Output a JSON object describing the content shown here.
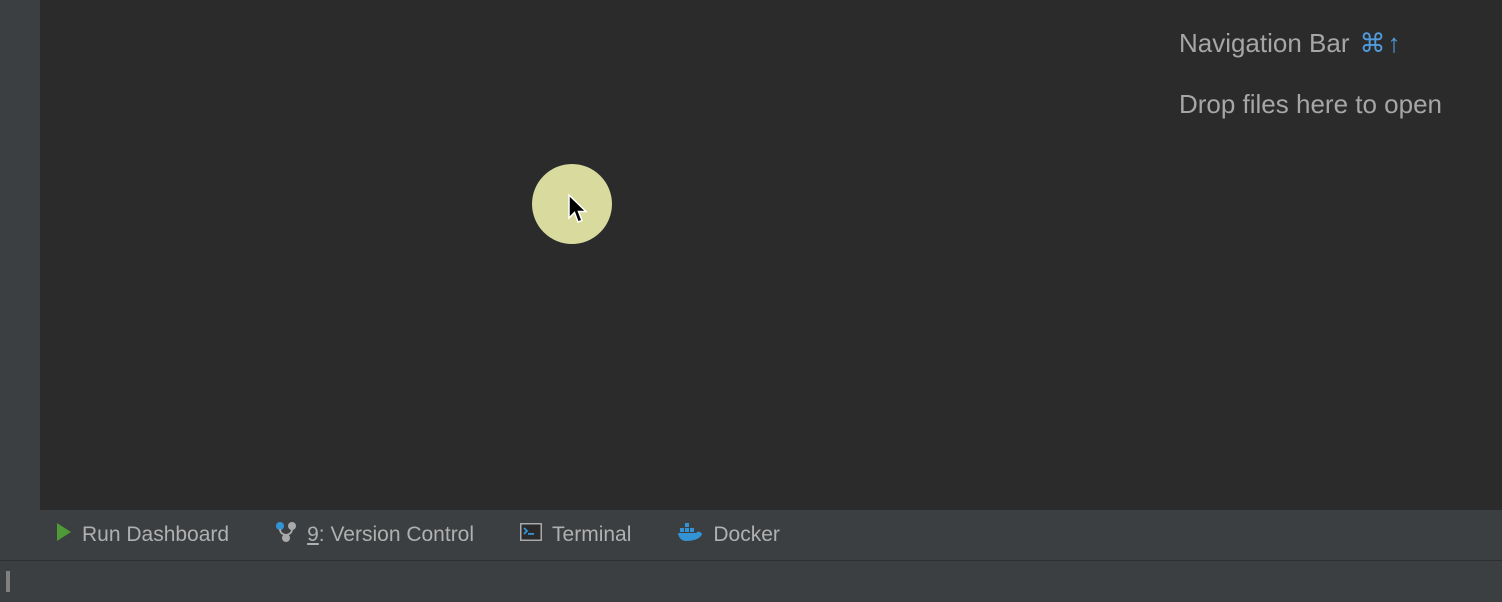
{
  "hints": {
    "navbar_label": "Navigation Bar",
    "navbar_shortcut_glyphs": {
      "cmd": "⌘",
      "arrow": "↑"
    },
    "drop_label": "Drop files here to open"
  },
  "tools": {
    "run_dashboard": "Run Dashboard",
    "version_control_mnemonic": "9",
    "version_control_label": ": Version Control",
    "terminal": "Terminal",
    "docker": "Docker"
  }
}
